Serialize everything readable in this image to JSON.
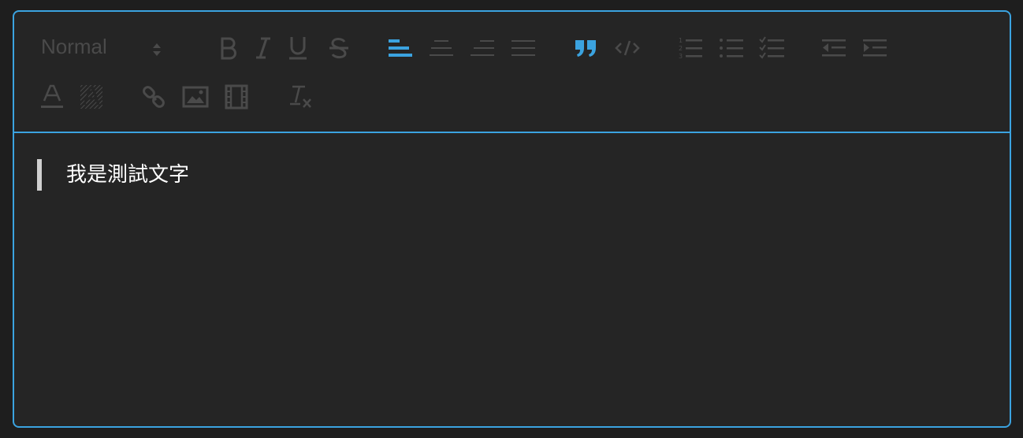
{
  "toolbar": {
    "header_select": {
      "value": "Normal"
    },
    "row1": [
      {
        "name": "bold-button",
        "icon": "bold-icon",
        "active": false
      },
      {
        "name": "italic-button",
        "icon": "italic-icon",
        "active": false
      },
      {
        "name": "underline-button",
        "icon": "underline-icon",
        "active": false
      },
      {
        "name": "strike-button",
        "icon": "strikethrough-icon",
        "active": false
      },
      {
        "name": "align-left-button",
        "icon": "align-left-icon",
        "active": true
      },
      {
        "name": "align-center-button",
        "icon": "align-center-icon",
        "active": false
      },
      {
        "name": "align-right-button",
        "icon": "align-right-icon",
        "active": false
      },
      {
        "name": "align-justify-button",
        "icon": "align-justify-icon",
        "active": false
      },
      {
        "name": "blockquote-button",
        "icon": "blockquote-icon",
        "active": true
      },
      {
        "name": "code-block-button",
        "icon": "code-icon",
        "active": false
      },
      {
        "name": "ordered-list-button",
        "icon": "ordered-list-icon",
        "active": false
      },
      {
        "name": "bullet-list-button",
        "icon": "bullet-list-icon",
        "active": false
      },
      {
        "name": "check-list-button",
        "icon": "check-list-icon",
        "active": false
      },
      {
        "name": "outdent-button",
        "icon": "outdent-icon",
        "active": false
      },
      {
        "name": "indent-button",
        "icon": "indent-icon",
        "active": false
      }
    ],
    "row2": [
      {
        "name": "text-color-button",
        "icon": "text-color-icon",
        "active": false
      },
      {
        "name": "background-color-button",
        "icon": "background-color-icon",
        "active": false
      },
      {
        "name": "link-button",
        "icon": "link-icon",
        "active": false
      },
      {
        "name": "image-button",
        "icon": "image-icon",
        "active": false
      },
      {
        "name": "video-button",
        "icon": "video-icon",
        "active": false
      },
      {
        "name": "clear-format-button",
        "icon": "clear-format-icon",
        "active": false
      }
    ]
  },
  "content": {
    "blockquote_text": "我是測試文字"
  },
  "colors": {
    "accent": "#3ba3e0",
    "icon_inactive": "#4a4a4a",
    "background": "#252525",
    "text": "#ffffff"
  }
}
